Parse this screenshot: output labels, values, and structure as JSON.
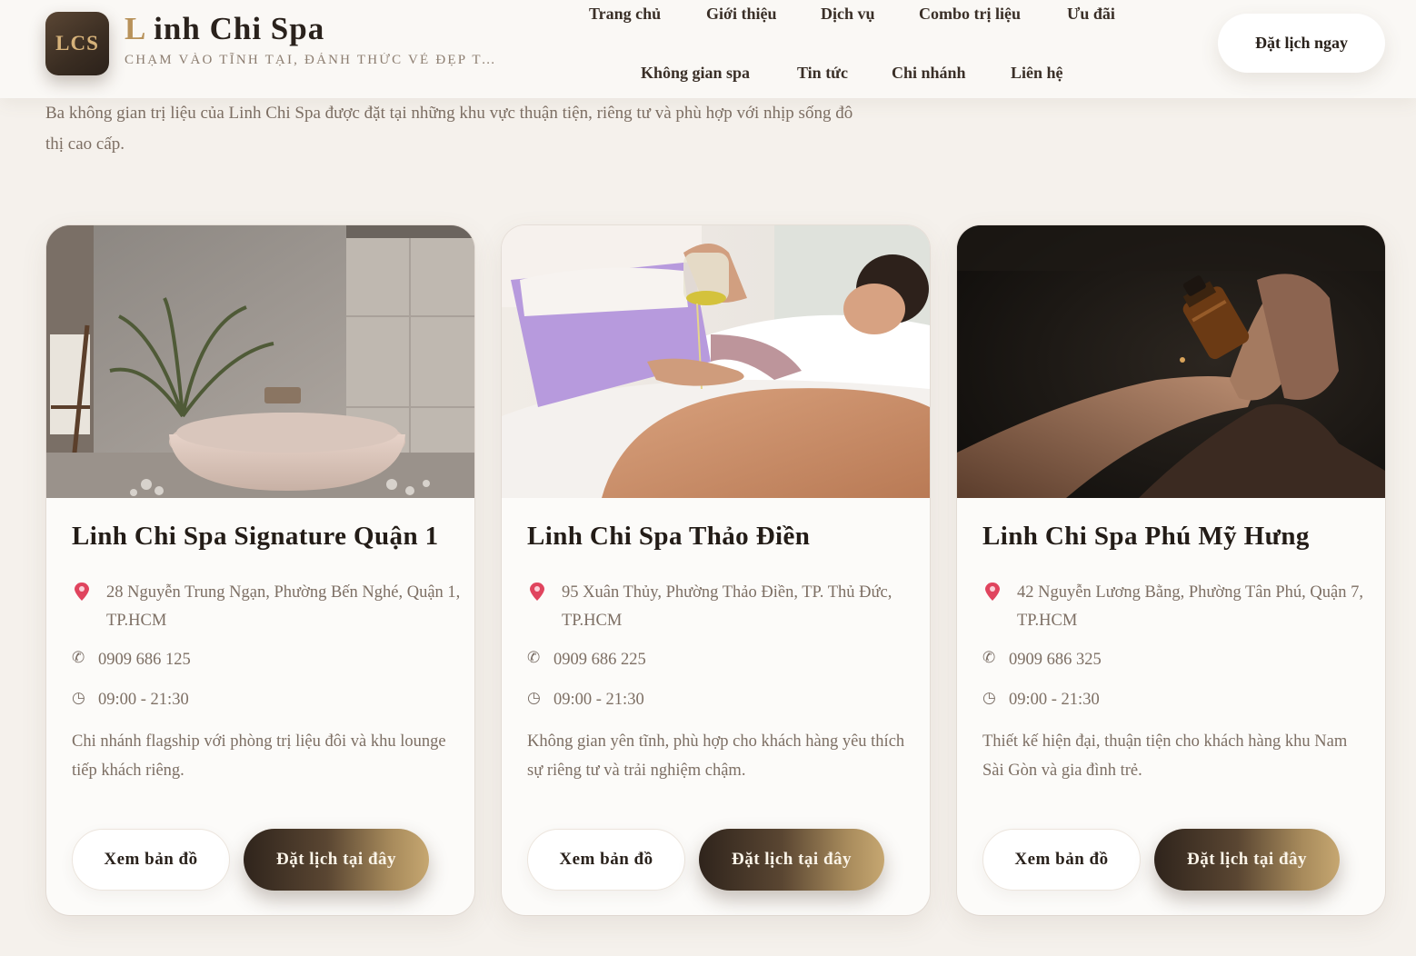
{
  "header": {
    "logo_text": "LCS",
    "brand_initial": "L",
    "brand_rest": "inh Chi Spa",
    "tagline": "CHẠM VÀO TĨNH TẠI, ĐÁNH THỨC VẺ ĐẸP T...",
    "nav": [
      {
        "label": "Trang chủ"
      },
      {
        "label": "Giới thiệu"
      },
      {
        "label": "Dịch vụ"
      },
      {
        "label": "Combo trị liệu"
      },
      {
        "label": "Ưu đãi"
      },
      {
        "label": "Không gian spa"
      },
      {
        "label": "Tin tức"
      },
      {
        "label": "Chi nhánh"
      },
      {
        "label": "Liên hệ"
      }
    ],
    "cta_label": "Đặt lịch ngay"
  },
  "intro": "Ba không gian trị liệu của Linh Chi Spa được đặt tại những khu vực thuận tiện, riêng tư và phù hợp với nhịp sống đô thị cao cấp.",
  "branches": [
    {
      "name": "Linh Chi Spa Signature Quận 1",
      "address": "28 Nguyễn Trung Ngạn, Phường Bến Nghé, Quận 1, TP.HCM",
      "phone": "0909 686 125",
      "hours": "09:00 - 21:30",
      "description": "Chi nhánh flagship với phòng trị liệu đôi và khu lounge tiếp khách riêng.",
      "map_label": "Xem bản đồ",
      "book_label": "Đặt lịch tại đây"
    },
    {
      "name": "Linh Chi Spa Thảo Điền",
      "address": "95 Xuân Thủy, Phường Thảo Điền, TP. Thủ Đức, TP.HCM",
      "phone": "0909 686 225",
      "hours": "09:00 - 21:30",
      "description": "Không gian yên tĩnh, phù hợp cho khách hàng yêu thích sự riêng tư và trải nghiệm chậm.",
      "map_label": "Xem bản đồ",
      "book_label": "Đặt lịch tại đây"
    },
    {
      "name": "Linh Chi Spa Phú Mỹ Hưng",
      "address": "42 Nguyễn Lương Bằng, Phường Tân Phú, Quận 7, TP.HCM",
      "phone": "0909 686 325",
      "hours": "09:00 - 21:30",
      "description": "Thiết kế hiện đại, thuận tiện cho khách hàng khu Nam Sài Gòn và gia đình trẻ.",
      "map_label": "Xem bản đồ",
      "book_label": "Đặt lịch tại đây"
    }
  ],
  "icons": {
    "address": "map-pin-icon",
    "phone": "phone-icon",
    "hours": "clock-icon",
    "phone_glyph": "✆",
    "clock_glyph": "◷"
  },
  "colors": {
    "page_bg": "#f5f1ec",
    "accent_gold": "#b8925a",
    "button_dark": "#2f241c",
    "text_muted": "#7d6f64",
    "pin_red": "#e0445e"
  }
}
